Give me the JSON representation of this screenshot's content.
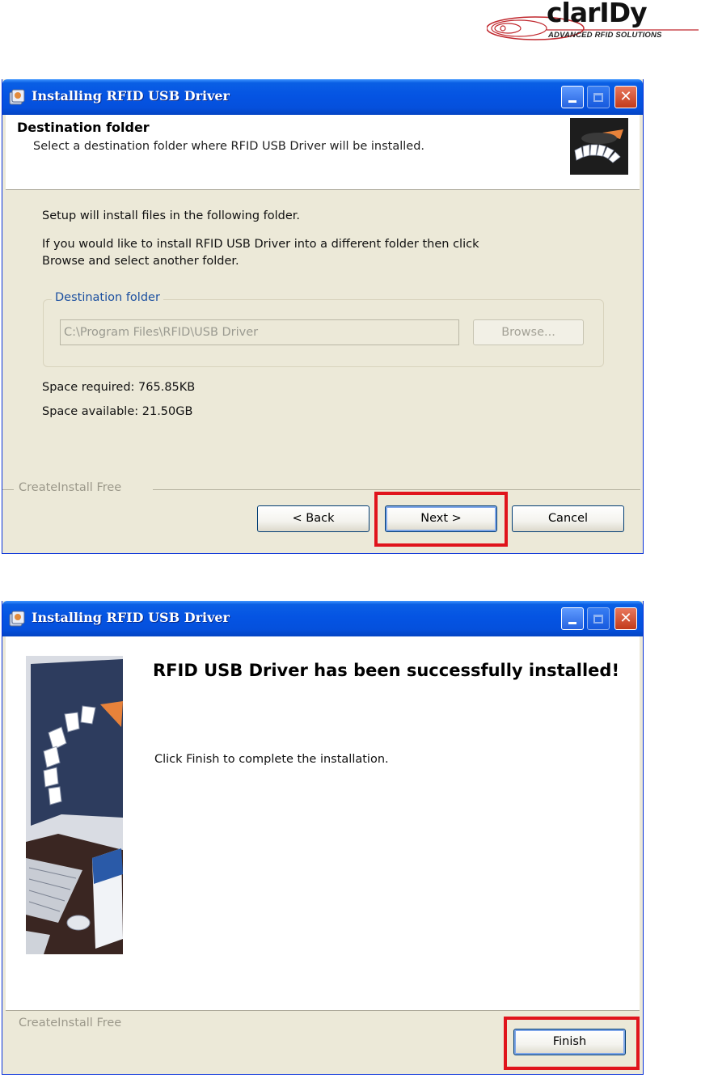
{
  "logo": {
    "name": "clarIDy",
    "tagline": "ADVANCED RFID SOLUTIONS"
  },
  "dialog1": {
    "title": "Installing RFID USB Driver",
    "header_title": "Destination folder",
    "header_subtitle": "Select a destination folder where RFID USB Driver will be installed.",
    "line1": "Setup will install files in the following folder.",
    "line2a": "If you would like to install RFID USB Driver into a different folder then click",
    "line2b": "Browse and select another folder.",
    "group_label": "Destination folder",
    "path_value": "C:\\Program Files\\RFID\\USB Driver",
    "browse_label": "Browse...",
    "space_required": "Space required: 765.85KB",
    "space_available": "Space available: 21.50GB",
    "footer_brand": "CreateInstall Free",
    "back_label": "< Back",
    "next_label": "Next >",
    "cancel_label": "Cancel"
  },
  "dialog2": {
    "title": "Installing RFID USB Driver",
    "success_title": "RFID USB Driver has been successfully installed!",
    "success_subtitle": "Click Finish to complete the installation.",
    "footer_brand": "CreateInstall Free",
    "finish_label": "Finish"
  },
  "colors": {
    "titlebar": "#0554e3",
    "dialog_bg": "#ece9d8",
    "highlight": "#e0141c",
    "group_label": "#1b4fa0"
  },
  "icons": [
    "installer-icon",
    "minimize-icon",
    "maximize-icon",
    "close-icon"
  ]
}
